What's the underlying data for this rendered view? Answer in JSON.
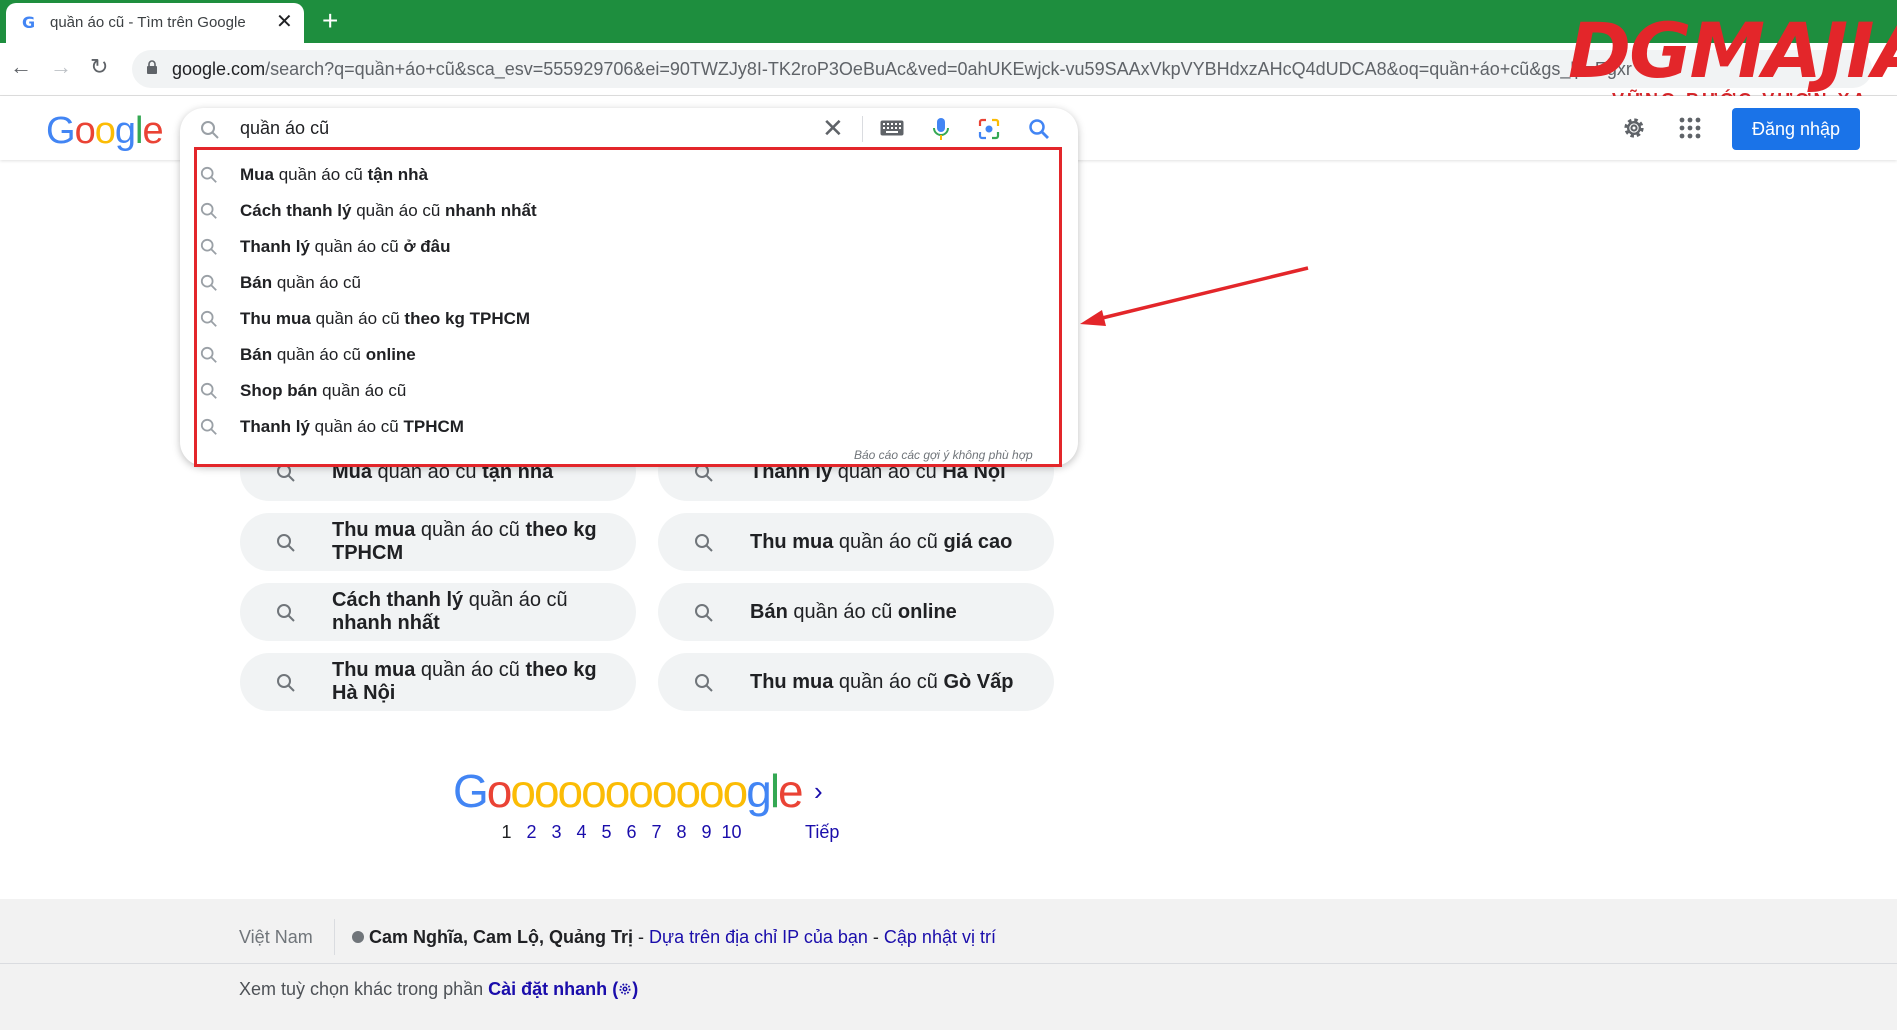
{
  "browser": {
    "tab_title": "quần áo cũ - Tìm trên Google",
    "tab_close": "✕",
    "new_tab": "+",
    "url_host": "google.com",
    "url_rest": "/search?q=quần+áo+cũ&sca_esv=555929706&ei=90TWZJy8I-TK2roP3OeBuAc&ved=0ahUKEwjck-vu59SAAxVkpVYBHdxzAHcQ4dUDCA8&oq=quần+áo+cũ&gs_lp=Egxr"
  },
  "brand": {
    "name": "DGMAJIA",
    "tagline": "VỮNG BƯỚC VƯƠN XA"
  },
  "header": {
    "signin_label": "Đăng nhập"
  },
  "search": {
    "query": "quần áo cũ",
    "clear": "✕"
  },
  "suggestions": [
    {
      "pre": "Mua",
      "mid": " quần áo cũ ",
      "post": "tận nhà"
    },
    {
      "pre": "Cách thanh lý",
      "mid": " quần áo cũ ",
      "post": "nhanh nhất"
    },
    {
      "pre": "Thanh lý",
      "mid": " quần áo cũ ",
      "post": "ở đâu"
    },
    {
      "pre": "Bán",
      "mid": " quần áo cũ",
      "post": ""
    },
    {
      "pre": "Thu mua",
      "mid": " quần áo cũ ",
      "post": "theo kg TPHCM"
    },
    {
      "pre": "Bán",
      "mid": " quần áo cũ ",
      "post": "online"
    },
    {
      "pre": "Shop bán",
      "mid": " quần áo cũ",
      "post": ""
    },
    {
      "pre": "Thanh lý",
      "mid": " quần áo cũ ",
      "post": "TPHCM"
    }
  ],
  "report_text": "Báo cáo các gợi ý không phù hợp",
  "related": [
    {
      "pre": "Mua",
      "mid": " quần áo cũ ",
      "post": "tận nhà"
    },
    {
      "pre": "Thanh lý",
      "mid": " quần áo cũ ",
      "post": "Hà Nội"
    },
    {
      "pre": "Thu mua",
      "mid": " quần áo cũ ",
      "post": "theo kg TPHCM"
    },
    {
      "pre": "Thu mua",
      "mid": " quần áo cũ ",
      "post": "giá cao"
    },
    {
      "pre": "Cách thanh lý",
      "mid": " quần áo cũ ",
      "post": "nhanh nhất"
    },
    {
      "pre": "Bán",
      "mid": " quần áo cũ ",
      "post": "online"
    },
    {
      "pre": "Thu mua",
      "mid": " quần áo cũ ",
      "post": "theo kg Hà Nội"
    },
    {
      "pre": "Thu mua",
      "mid": " quần áo cũ ",
      "post": "Gò Vấp"
    }
  ],
  "pagination": {
    "pages": [
      "1",
      "2",
      "3",
      "4",
      "5",
      "6",
      "7",
      "8",
      "9",
      "10"
    ],
    "current": "1",
    "next_label": "Tiếp",
    "next_chevron": "›"
  },
  "footer": {
    "country": "Việt Nam",
    "location": "Cam Nghĩa, Cam Lộ, Quảng Trị",
    "sep1": " - ",
    "ip_link": "Dựa trên địa chỉ IP của bạn",
    "sep2": " - ",
    "update_link": "Cập nhật vị trí",
    "settings_text": "Xem tuỳ chọn khác trong phần ",
    "settings_link": "Cài đặt nhanh",
    "settings_open": "(",
    "settings_close": ")"
  },
  "colors": {
    "chrome_green": "#1e8e3e",
    "google_blue": "#4285f4",
    "google_red": "#ea4335",
    "google_yellow": "#fbbc05",
    "google_green": "#34a853",
    "highlight_red": "#e3262a",
    "signin_blue": "#1a73e8"
  }
}
